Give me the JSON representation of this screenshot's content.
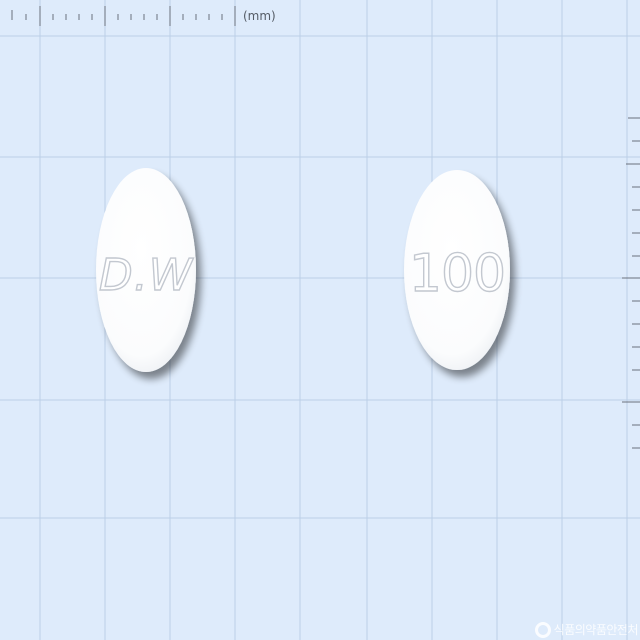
{
  "ruler": {
    "unit_label": "(mm)"
  },
  "tablets": [
    {
      "side": "front",
      "imprint": "D.W"
    },
    {
      "side": "back",
      "imprint": "100"
    }
  ],
  "watermark": {
    "text": "식품의약품안전처",
    "icon": "mfds-logo-icon"
  },
  "colors": {
    "background": "#deebfb",
    "grid": "#b9cde6",
    "tablet": "#ffffff",
    "imprint": "#c7ccd4"
  }
}
